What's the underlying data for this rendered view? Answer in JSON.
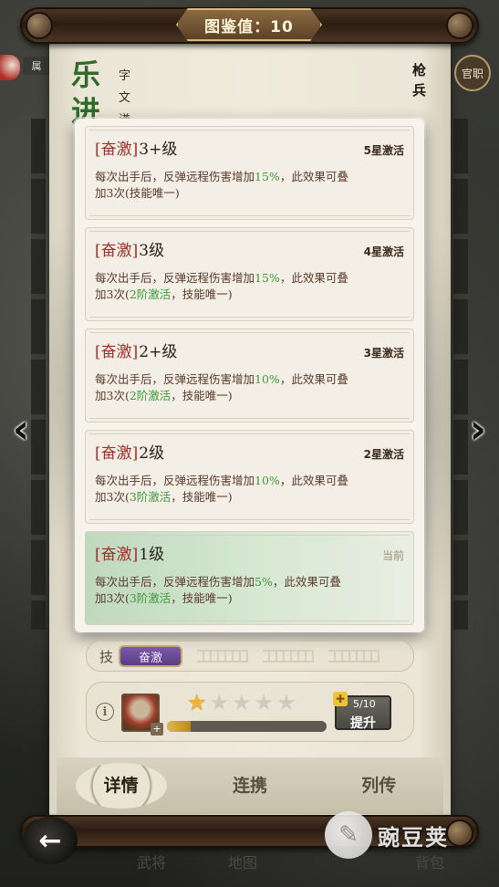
{
  "header": {
    "collection_value": "图鉴值：10"
  },
  "character": {
    "name": "乐进",
    "courtesy": "字文谦",
    "unit_type": "枪兵",
    "rank_seal": "官职",
    "side_tag": "属"
  },
  "popup": {
    "cards": [
      {
        "tag": "[奋激]",
        "level": "3+级",
        "status": "5星激活",
        "desc_a": "每次出手后，反弹远程伤害增加",
        "pct": "15%",
        "desc_b": "，此效果可叠",
        "desc_c": "加3次(",
        "req": "",
        "desc_d": "技能唯一)"
      },
      {
        "tag": "[奋激]",
        "level": "3级",
        "status": "4星激活",
        "desc_a": "每次出手后，反弹远程伤害增加",
        "pct": "15%",
        "desc_b": "，此效果可叠",
        "desc_c": "加3次(",
        "req": "2阶激活",
        "desc_d": "，技能唯一)"
      },
      {
        "tag": "[奋激]",
        "level": "2+级",
        "status": "3星激活",
        "desc_a": "每次出手后，反弹远程伤害增加",
        "pct": "10%",
        "desc_b": "，此效果可叠",
        "desc_c": "加3次(",
        "req": "2阶激活",
        "desc_d": "，技能唯一)"
      },
      {
        "tag": "[奋激]",
        "level": "2级",
        "status": "2星激活",
        "desc_a": "每次出手后，反弹远程伤害增加",
        "pct": "10%",
        "desc_b": "，此效果可叠",
        "desc_c": "加3次(",
        "req": "3阶激活",
        "desc_d": "，技能唯一)"
      },
      {
        "tag": "[奋激]",
        "level": "1级",
        "status": "当前",
        "desc_a": "每次出手后，反弹远程伤害增加",
        "pct": "5%",
        "desc_b": "，此效果可叠",
        "desc_c": "加3次(",
        "req": "3阶激活",
        "desc_d": "，技能唯一)"
      }
    ]
  },
  "skill": {
    "label": "技",
    "chip": "奋激"
  },
  "stars": {
    "filled": 1,
    "total": 5,
    "shards": "5/10",
    "upgrade_label": "提升",
    "progress_fraction": 0.15
  },
  "tabs": {
    "details": "详情",
    "bonds": "连携",
    "biography": "列传"
  },
  "ghost_nav": {
    "a": "武将",
    "b": "地图",
    "c": "背包"
  },
  "watermark": {
    "text": "豌豆荚"
  },
  "colors": {
    "highlight_green": "#3e9a3a",
    "tag_red": "#a0302a",
    "star_gold": "#f0b532"
  }
}
